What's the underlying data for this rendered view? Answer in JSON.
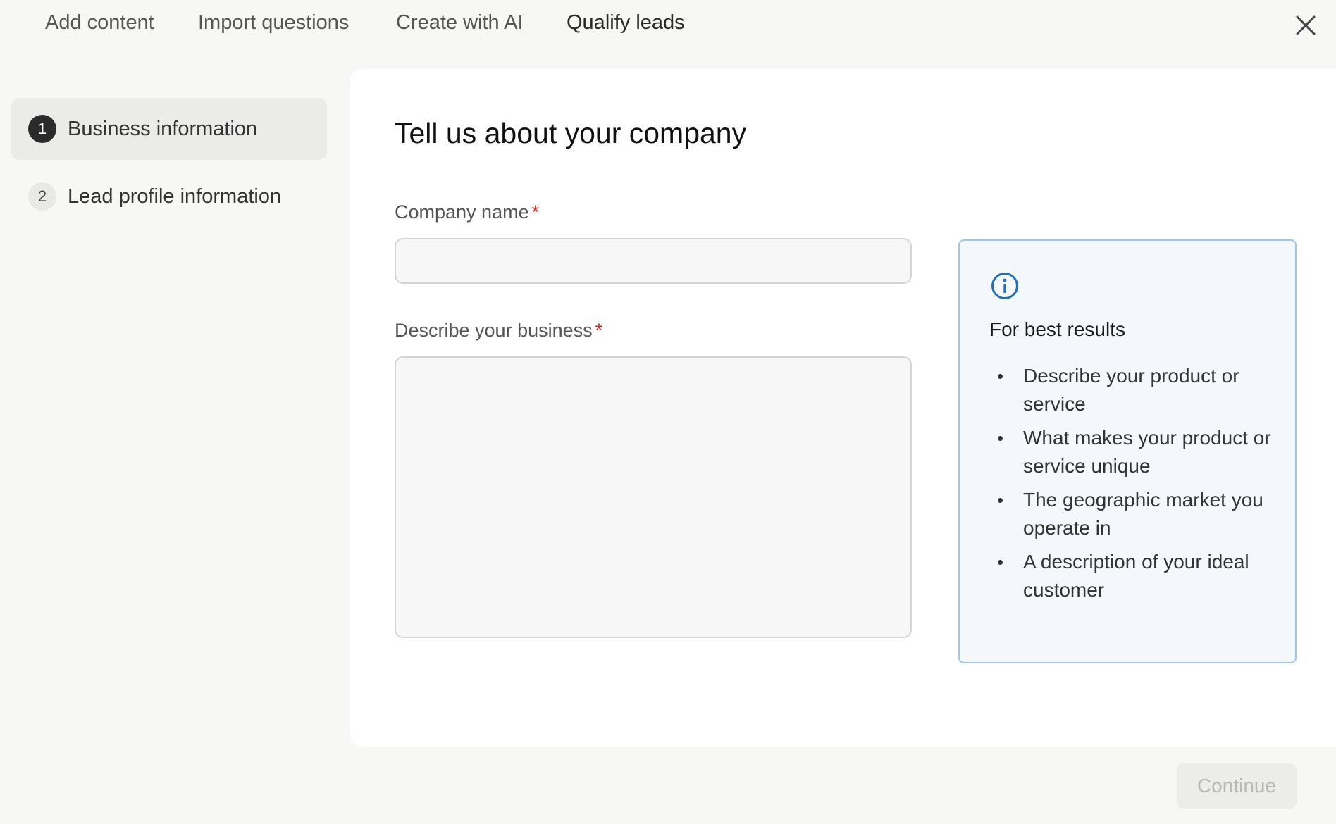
{
  "tabs": [
    {
      "label": "Add content"
    },
    {
      "label": "Import questions"
    },
    {
      "label": "Create with AI"
    },
    {
      "label": "Qualify leads"
    }
  ],
  "active_tab": "Qualify leads",
  "steps": [
    {
      "number": "1",
      "label": "Business information",
      "active": true
    },
    {
      "number": "2",
      "label": "Lead profile information",
      "active": false
    }
  ],
  "main": {
    "title": "Tell us about your company",
    "company_name": {
      "label": "Company name",
      "required_mark": "*",
      "value": "",
      "placeholder": ""
    },
    "business_description": {
      "label": "Describe your business",
      "required_mark": "*",
      "value": "",
      "placeholder": ""
    }
  },
  "info_panel": {
    "icon": "info-icon",
    "title": "For best results",
    "items": [
      "Describe your product or service",
      "What makes your product or service unique",
      "The geographic market you operate in",
      "A description of your ideal customer"
    ]
  },
  "footer": {
    "continue_label": "Continue"
  },
  "colors": {
    "required": "#cc1f1f",
    "info_border": "#9cc6ee",
    "info_icon": "#1f6fbf",
    "active_step_badge": "#2b2b2b"
  }
}
